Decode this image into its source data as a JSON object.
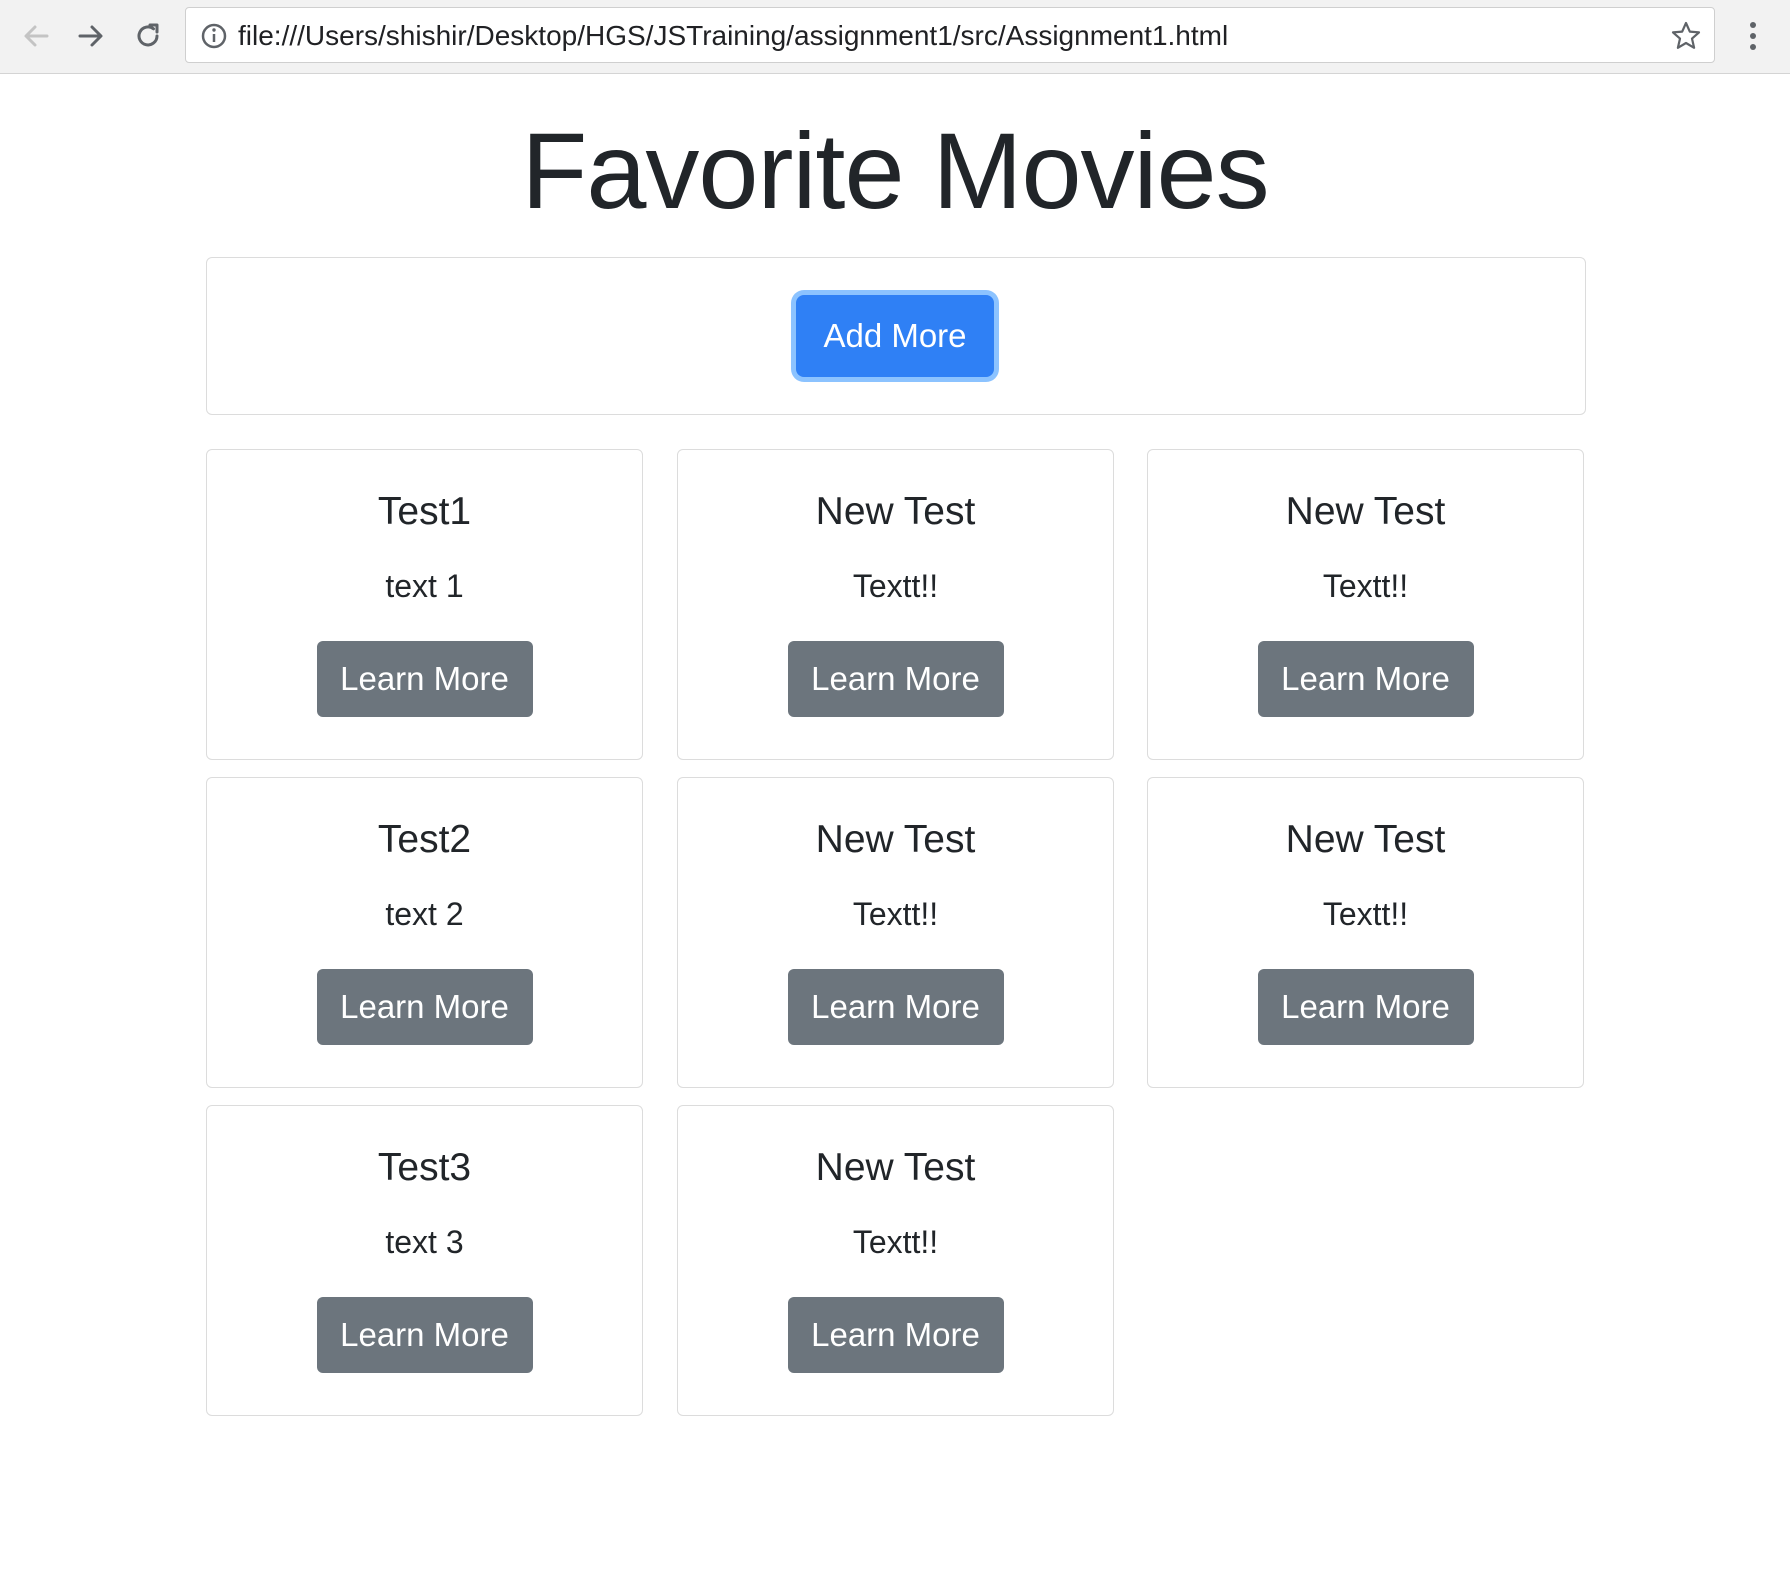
{
  "browser": {
    "url": "file:///Users/shishir/Desktop/HGS/JSTraining/assignment1/src/Assignment1.html",
    "icons": {
      "back": "arrow-left-icon",
      "forward": "arrow-right-icon",
      "reload": "reload-icon",
      "info": "info-icon",
      "bookmark": "star-icon",
      "menu": "kebab-menu-icon"
    }
  },
  "page": {
    "title": "Favorite Movies",
    "add_button_label": "Add More",
    "accent_color": "#2f80f5",
    "secondary_color": "#6c757d"
  },
  "cards": [
    {
      "title": "Test1",
      "text": "text 1",
      "button": "Learn More"
    },
    {
      "title": "New Test",
      "text": "Textt!!",
      "button": "Learn More"
    },
    {
      "title": "New Test",
      "text": "Textt!!",
      "button": "Learn More"
    },
    {
      "title": "Test2",
      "text": "text 2",
      "button": "Learn More"
    },
    {
      "title": "New Test",
      "text": "Textt!!",
      "button": "Learn More"
    },
    {
      "title": "New Test",
      "text": "Textt!!",
      "button": "Learn More"
    },
    {
      "title": "Test3",
      "text": "text 3",
      "button": "Learn More"
    },
    {
      "title": "New Test",
      "text": "Textt!!",
      "button": "Learn More"
    }
  ]
}
